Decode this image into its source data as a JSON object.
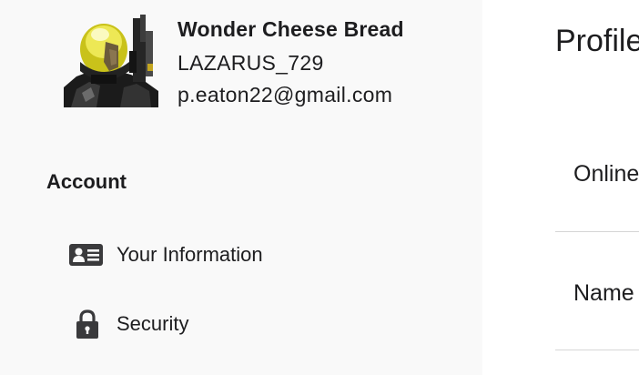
{
  "profile": {
    "display_name": "Wonder Cheese Bread",
    "gamertag": "LAZARUS_729",
    "email": "p.eaton22@gmail.com"
  },
  "sidebar": {
    "section_title": "Account",
    "items": [
      {
        "label": "Your Information",
        "icon": "id-card-icon"
      },
      {
        "label": "Security",
        "icon": "lock-icon"
      }
    ]
  },
  "main": {
    "title": "Profile",
    "rows": [
      {
        "label": "Online"
      },
      {
        "label": "Name"
      }
    ]
  },
  "colors": {
    "sidebar_bg": "#f9f9f9",
    "text": "#1d1d1f",
    "icon": "#3a3a3c",
    "divider": "#d6d6d6"
  }
}
